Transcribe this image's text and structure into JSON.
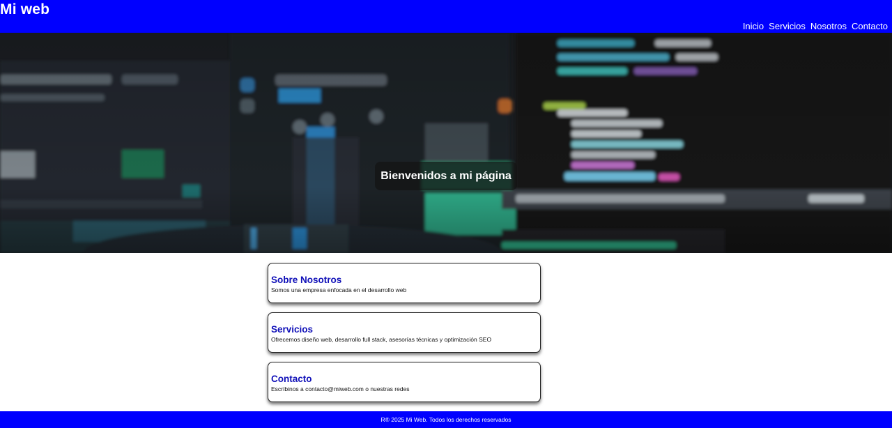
{
  "header": {
    "brand": "Mi web",
    "nav": [
      "Inicio",
      "Servicios",
      "Nosotros",
      "Contacto"
    ]
  },
  "hero": {
    "title": "Bienvenidos a mi página"
  },
  "sections": [
    {
      "title": "Sobre Nosotros",
      "text": "Somos una empresa enfocada en el desarrollo web"
    },
    {
      "title": "Servicios",
      "text": "Ofrecemos diseño web, desarrollo full stack, asesorías técnicas y optimización SEO"
    },
    {
      "title": "Contacto",
      "text": "Escríbinos a contacto@miweb.com o nuestras redes"
    }
  ],
  "footer": {
    "text": "R® 2025 Mi Web. Todos los derechos reservados"
  },
  "colors": {
    "header_bg": "#0000ff",
    "footer_bg": "#0000ff",
    "card_title": "#1010b8"
  }
}
